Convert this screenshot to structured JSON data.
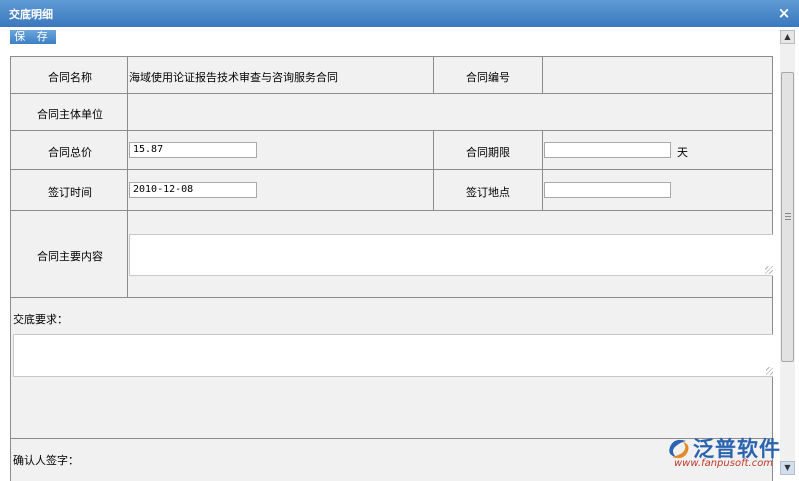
{
  "window": {
    "title": "交底明细"
  },
  "toolbar": {
    "save_label": "保 存"
  },
  "form": {
    "contract_name_label": "合同名称",
    "contract_name_value": "海域使用论证报告技术审查与咨询服务合同",
    "contract_no_label": "合同编号",
    "contract_no_value": "",
    "contract_entity_label": "合同主体单位",
    "contract_entity_value": "",
    "total_price_label": "合同总价",
    "total_price_value": "15.87",
    "term_label": "合同期限",
    "term_value": "",
    "term_unit": "天",
    "sign_date_label": "签订时间",
    "sign_date_value": "2010-12-08",
    "sign_place_label": "签订地点",
    "sign_place_value": "",
    "main_content_label": "合同主要内容",
    "main_content_value": "",
    "requirements_label": "交底要求：",
    "requirements_value": "",
    "confirm_sign_label": "确认人签字："
  },
  "logo": {
    "text": "泛普软件",
    "url": "www.fanpusoft.com"
  },
  "colors": {
    "titlebar": "#4a88c8",
    "label_bg": "#f1f1f1",
    "border": "#8c8c8c",
    "logo_blue": "#2a63b0"
  }
}
